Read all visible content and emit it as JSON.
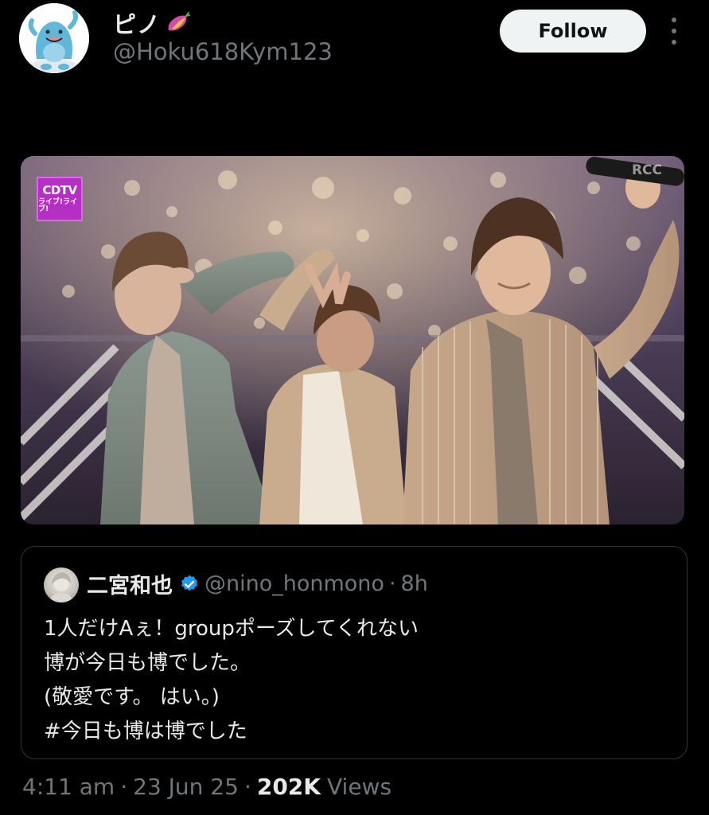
{
  "author": {
    "display_name": "ピノ",
    "handle": "@Hoku618Kym123",
    "avatar_icon": "quagsire-avatar-icon",
    "name_emoji_icon": "sweet-potato-icon"
  },
  "actions": {
    "follow_label": "Follow",
    "more_icon": "more-vertical-icon"
  },
  "media": {
    "channel_logo_line1": "CDTV",
    "channel_logo_line2": "ライブ!ライブ!",
    "broadcaster_mark": "RCC"
  },
  "quote": {
    "display_name": "二宮和也",
    "handle": "@nino_honmono",
    "separator": "·",
    "time": "8h",
    "verified_icon": "verified-badge-icon",
    "lines": [
      "1人だけAぇ！groupポーズしてくれない",
      "博が今日も博でした。",
      "(敬愛です。 はい。)",
      "#今日も博は博でした"
    ]
  },
  "meta": {
    "time": "4:11 am",
    "separator": "·",
    "date": "23 Jun 25",
    "views_count": "202K",
    "views_label": "Views"
  },
  "colors": {
    "background": "#000000",
    "text_primary": "#e7e9ea",
    "text_secondary": "#71767b",
    "border": "#2f3336",
    "follow_bg": "#eff3f4",
    "verified_blue": "#1d9bf0",
    "channel_logo": "#b62fc4"
  }
}
